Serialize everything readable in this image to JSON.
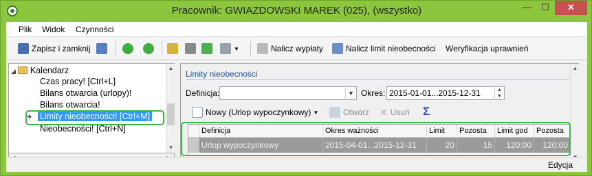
{
  "window": {
    "title": "Pracownik: GWIAZDOWSKI MAREK (025), (wszystko)",
    "min_glyph": "—",
    "max_glyph": "☐",
    "close_glyph": "✕"
  },
  "menu": [
    "Plik",
    "Widok",
    "Czynności"
  ],
  "toolbar": {
    "save_close_label": "Zapisz i zamknij",
    "calc_payments_label": "Nalicz wypłaty",
    "calc_limit_label": "Nalicz limit nieobecności",
    "verify_label": "Weryfikacja uprawnień"
  },
  "tree": {
    "root": "Kalendarz",
    "items": [
      "Czas pracy! [Ctrl+L]",
      "Bilans otwarcia (urlopy)!",
      "Bilans otwarcia!",
      "Limity nieobecności! [Ctrl+M]",
      "Nieobecności! [Ctrl+N]"
    ],
    "selected_index": 3
  },
  "panel": {
    "title": "Limity nieobecności",
    "definicja_label": "Definicja:",
    "definicja_value": "",
    "okres_label": "Okres:",
    "okres_value": "2015-01-01...2015-12-31",
    "new_label": "Nowy (Urlop wypoczynkowy)",
    "open_label": "Otwórz",
    "delete_label": "Usuń",
    "sum_glyph": "Σ"
  },
  "grid": {
    "headers": [
      "Definicja",
      "Okres ważności",
      "Limit",
      "Pozosta",
      "Limit god",
      "Pozosta"
    ],
    "rows": [
      [
        "Urlop wypoczynkowy",
        "2015-04-01...2015-12-31",
        "20",
        "15",
        "120:00",
        "120:00"
      ]
    ]
  },
  "status": {
    "mode": "Edycja"
  },
  "colors": {
    "window_frame": "#8cc63f",
    "panel_title": "#1f4e9a",
    "selection": "#3399ff",
    "highlight_border": "#3cb54a",
    "grid_row": "#9a9a9a"
  },
  "icons": {
    "save": "floppy-disk-icon",
    "back": "green-back-arrow-icon",
    "forward": "green-forward-arrow-icon",
    "calc": "wand-icon",
    "calc_limit": "document-wand-icon",
    "new": "new-document-icon",
    "sum": "sigma-icon"
  }
}
